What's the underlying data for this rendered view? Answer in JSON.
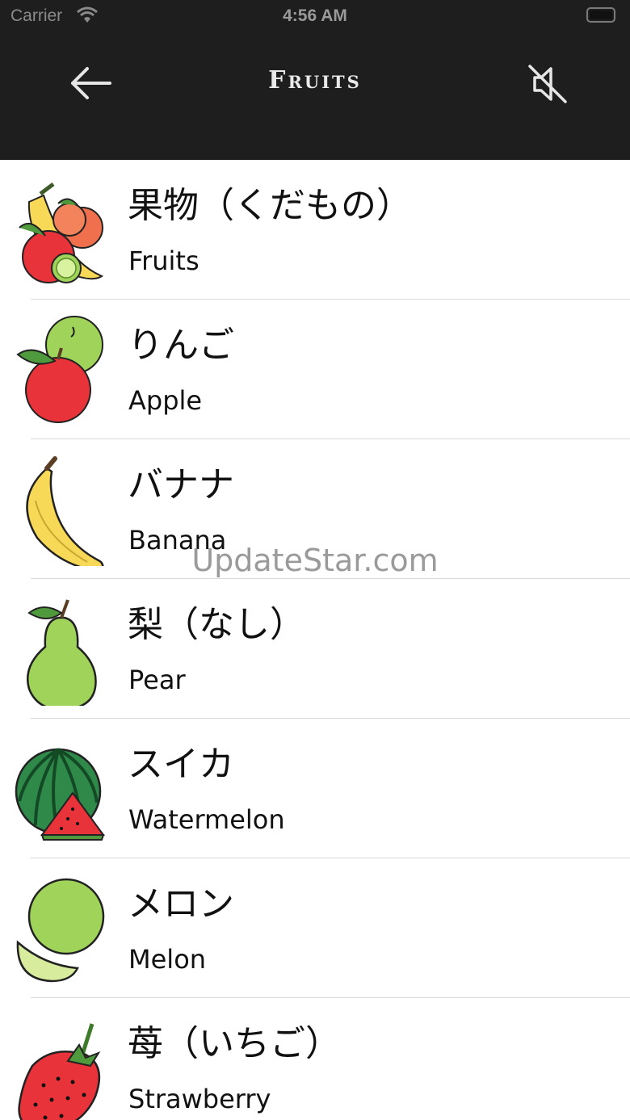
{
  "status_bar": {
    "carrier": "Carrier",
    "time": "4:56 AM"
  },
  "header": {
    "title": "Fruits",
    "back_icon": "arrow-left-icon",
    "mute_icon": "speaker-muted-icon"
  },
  "items": [
    {
      "jp": "果物（くだもの）",
      "en": "Fruits",
      "icon": "fruit-basket-icon"
    },
    {
      "jp": "りんご",
      "en": "Apple",
      "icon": "apple-icon"
    },
    {
      "jp": "バナナ",
      "en": "Banana",
      "icon": "banana-icon"
    },
    {
      "jp": "梨（なし）",
      "en": "Pear",
      "icon": "pear-icon"
    },
    {
      "jp": "スイカ",
      "en": "Watermelon",
      "icon": "watermelon-icon"
    },
    {
      "jp": "メロン",
      "en": "Melon",
      "icon": "melon-icon"
    },
    {
      "jp": "苺（いちご）",
      "en": "Strawberry",
      "icon": "strawberry-icon"
    }
  ],
  "watermark": "UpdateStar.com",
  "colors": {
    "header_bg": "#1e1e1e",
    "separator": "#d9d9d9"
  }
}
